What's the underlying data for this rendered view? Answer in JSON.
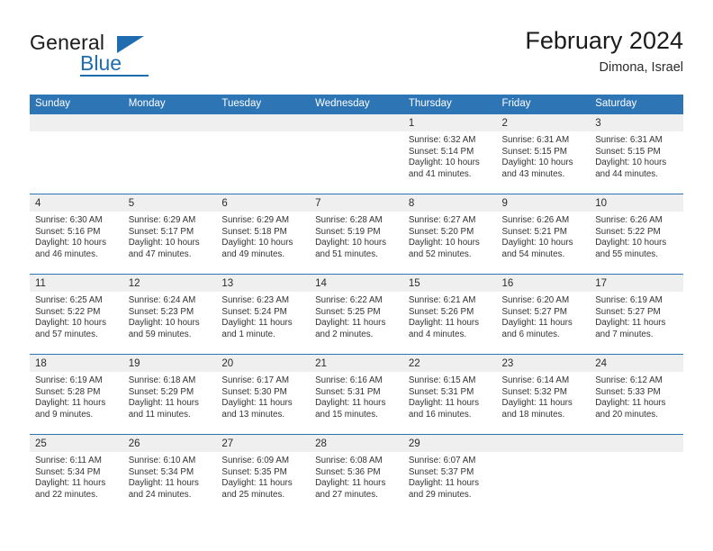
{
  "brand": {
    "name_top": "General",
    "name_bottom": "Blue",
    "triangle_color": "#1f6cb0"
  },
  "header": {
    "title": "February 2024",
    "subtitle": "Dimona, Israel"
  },
  "colors": {
    "header_blue": "#2e75b6",
    "daynum_band": "#efefef",
    "text": "#333333"
  },
  "weekday_headers": [
    "Sunday",
    "Monday",
    "Tuesday",
    "Wednesday",
    "Thursday",
    "Friday",
    "Saturday"
  ],
  "weeks": [
    [
      {
        "empty": true
      },
      {
        "empty": true
      },
      {
        "empty": true
      },
      {
        "empty": true
      },
      {
        "day": "1",
        "sunrise": "Sunrise: 6:32 AM",
        "sunset": "Sunset: 5:14 PM",
        "daylight_line1": "Daylight: 10 hours",
        "daylight_line2": "and 41 minutes."
      },
      {
        "day": "2",
        "sunrise": "Sunrise: 6:31 AM",
        "sunset": "Sunset: 5:15 PM",
        "daylight_line1": "Daylight: 10 hours",
        "daylight_line2": "and 43 minutes."
      },
      {
        "day": "3",
        "sunrise": "Sunrise: 6:31 AM",
        "sunset": "Sunset: 5:15 PM",
        "daylight_line1": "Daylight: 10 hours",
        "daylight_line2": "and 44 minutes."
      }
    ],
    [
      {
        "day": "4",
        "sunrise": "Sunrise: 6:30 AM",
        "sunset": "Sunset: 5:16 PM",
        "daylight_line1": "Daylight: 10 hours",
        "daylight_line2": "and 46 minutes."
      },
      {
        "day": "5",
        "sunrise": "Sunrise: 6:29 AM",
        "sunset": "Sunset: 5:17 PM",
        "daylight_line1": "Daylight: 10 hours",
        "daylight_line2": "and 47 minutes."
      },
      {
        "day": "6",
        "sunrise": "Sunrise: 6:29 AM",
        "sunset": "Sunset: 5:18 PM",
        "daylight_line1": "Daylight: 10 hours",
        "daylight_line2": "and 49 minutes."
      },
      {
        "day": "7",
        "sunrise": "Sunrise: 6:28 AM",
        "sunset": "Sunset: 5:19 PM",
        "daylight_line1": "Daylight: 10 hours",
        "daylight_line2": "and 51 minutes."
      },
      {
        "day": "8",
        "sunrise": "Sunrise: 6:27 AM",
        "sunset": "Sunset: 5:20 PM",
        "daylight_line1": "Daylight: 10 hours",
        "daylight_line2": "and 52 minutes."
      },
      {
        "day": "9",
        "sunrise": "Sunrise: 6:26 AM",
        "sunset": "Sunset: 5:21 PM",
        "daylight_line1": "Daylight: 10 hours",
        "daylight_line2": "and 54 minutes."
      },
      {
        "day": "10",
        "sunrise": "Sunrise: 6:26 AM",
        "sunset": "Sunset: 5:22 PM",
        "daylight_line1": "Daylight: 10 hours",
        "daylight_line2": "and 55 minutes."
      }
    ],
    [
      {
        "day": "11",
        "sunrise": "Sunrise: 6:25 AM",
        "sunset": "Sunset: 5:22 PM",
        "daylight_line1": "Daylight: 10 hours",
        "daylight_line2": "and 57 minutes."
      },
      {
        "day": "12",
        "sunrise": "Sunrise: 6:24 AM",
        "sunset": "Sunset: 5:23 PM",
        "daylight_line1": "Daylight: 10 hours",
        "daylight_line2": "and 59 minutes."
      },
      {
        "day": "13",
        "sunrise": "Sunrise: 6:23 AM",
        "sunset": "Sunset: 5:24 PM",
        "daylight_line1": "Daylight: 11 hours",
        "daylight_line2": "and 1 minute."
      },
      {
        "day": "14",
        "sunrise": "Sunrise: 6:22 AM",
        "sunset": "Sunset: 5:25 PM",
        "daylight_line1": "Daylight: 11 hours",
        "daylight_line2": "and 2 minutes."
      },
      {
        "day": "15",
        "sunrise": "Sunrise: 6:21 AM",
        "sunset": "Sunset: 5:26 PM",
        "daylight_line1": "Daylight: 11 hours",
        "daylight_line2": "and 4 minutes."
      },
      {
        "day": "16",
        "sunrise": "Sunrise: 6:20 AM",
        "sunset": "Sunset: 5:27 PM",
        "daylight_line1": "Daylight: 11 hours",
        "daylight_line2": "and 6 minutes."
      },
      {
        "day": "17",
        "sunrise": "Sunrise: 6:19 AM",
        "sunset": "Sunset: 5:27 PM",
        "daylight_line1": "Daylight: 11 hours",
        "daylight_line2": "and 7 minutes."
      }
    ],
    [
      {
        "day": "18",
        "sunrise": "Sunrise: 6:19 AM",
        "sunset": "Sunset: 5:28 PM",
        "daylight_line1": "Daylight: 11 hours",
        "daylight_line2": "and 9 minutes."
      },
      {
        "day": "19",
        "sunrise": "Sunrise: 6:18 AM",
        "sunset": "Sunset: 5:29 PM",
        "daylight_line1": "Daylight: 11 hours",
        "daylight_line2": "and 11 minutes."
      },
      {
        "day": "20",
        "sunrise": "Sunrise: 6:17 AM",
        "sunset": "Sunset: 5:30 PM",
        "daylight_line1": "Daylight: 11 hours",
        "daylight_line2": "and 13 minutes."
      },
      {
        "day": "21",
        "sunrise": "Sunrise: 6:16 AM",
        "sunset": "Sunset: 5:31 PM",
        "daylight_line1": "Daylight: 11 hours",
        "daylight_line2": "and 15 minutes."
      },
      {
        "day": "22",
        "sunrise": "Sunrise: 6:15 AM",
        "sunset": "Sunset: 5:31 PM",
        "daylight_line1": "Daylight: 11 hours",
        "daylight_line2": "and 16 minutes."
      },
      {
        "day": "23",
        "sunrise": "Sunrise: 6:14 AM",
        "sunset": "Sunset: 5:32 PM",
        "daylight_line1": "Daylight: 11 hours",
        "daylight_line2": "and 18 minutes."
      },
      {
        "day": "24",
        "sunrise": "Sunrise: 6:12 AM",
        "sunset": "Sunset: 5:33 PM",
        "daylight_line1": "Daylight: 11 hours",
        "daylight_line2": "and 20 minutes."
      }
    ],
    [
      {
        "day": "25",
        "sunrise": "Sunrise: 6:11 AM",
        "sunset": "Sunset: 5:34 PM",
        "daylight_line1": "Daylight: 11 hours",
        "daylight_line2": "and 22 minutes."
      },
      {
        "day": "26",
        "sunrise": "Sunrise: 6:10 AM",
        "sunset": "Sunset: 5:34 PM",
        "daylight_line1": "Daylight: 11 hours",
        "daylight_line2": "and 24 minutes."
      },
      {
        "day": "27",
        "sunrise": "Sunrise: 6:09 AM",
        "sunset": "Sunset: 5:35 PM",
        "daylight_line1": "Daylight: 11 hours",
        "daylight_line2": "and 25 minutes."
      },
      {
        "day": "28",
        "sunrise": "Sunrise: 6:08 AM",
        "sunset": "Sunset: 5:36 PM",
        "daylight_line1": "Daylight: 11 hours",
        "daylight_line2": "and 27 minutes."
      },
      {
        "day": "29",
        "sunrise": "Sunrise: 6:07 AM",
        "sunset": "Sunset: 5:37 PM",
        "daylight_line1": "Daylight: 11 hours",
        "daylight_line2": "and 29 minutes."
      },
      {
        "empty": true
      },
      {
        "empty": true
      }
    ]
  ]
}
